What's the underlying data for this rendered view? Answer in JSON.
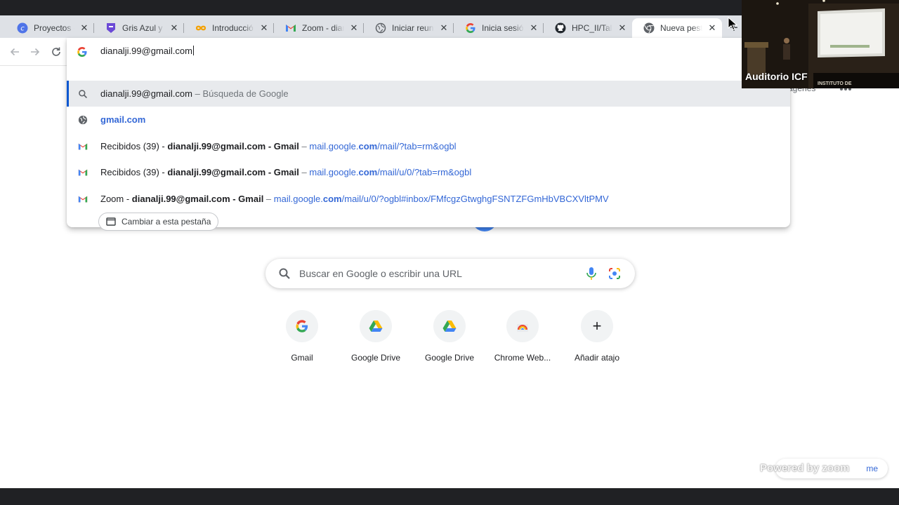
{
  "tabs": [
    {
      "label": "Proyectos - G",
      "icon": "canva-icon",
      "close": "✕"
    },
    {
      "label": "Gris Azul y N",
      "icon": "shield-icon",
      "close": "✕"
    },
    {
      "label": "Introducción",
      "icon": "infinity-icon",
      "close": "✕"
    },
    {
      "label": "Zoom - diana",
      "icon": "gmail-icon",
      "close": "✕"
    },
    {
      "label": "Iniciar reunió",
      "icon": "globe-icon",
      "close": "✕"
    },
    {
      "label": "Inicia sesión",
      "icon": "google-icon",
      "close": "✕"
    },
    {
      "label": "HPC_II/Taller",
      "icon": "github-icon",
      "close": "✕"
    },
    {
      "label": "Nueva pestañ",
      "icon": "chrome-icon",
      "close": "✕",
      "active": true
    }
  ],
  "new_tab_glyph": "+",
  "omnibox": {
    "value": "dianalji.99@gmail.com"
  },
  "suggestions": {
    "search": {
      "query": "dianalji.99@gmail.com",
      "sep": " – ",
      "hint": "Búsqueda de Google"
    },
    "site": {
      "label": "gmail.com"
    },
    "gmail1": {
      "pre": "Recibidos (39) - ",
      "bold": "dianalji.99@gmail.com - Gmail",
      "sep": " – ",
      "url_a": "mail.google.",
      "url_b": "com",
      "url_c": "/mail/?tab=rm&ogbl"
    },
    "gmail2": {
      "pre": "Recibidos (39) - ",
      "bold": "dianalji.99@gmail.com - Gmail",
      "sep": " – ",
      "url_a": "mail.google.",
      "url_b": "com",
      "url_c": "/mail/u/0/?tab=rm&ogbl"
    },
    "gmail3": {
      "pre": "Zoom - ",
      "bold": "dianalji.99@gmail.com - Gmail",
      "sep": " – ",
      "url_a": "mail.google.",
      "url_b": "com",
      "url_c": "/mail/u/0/?ogbl#inbox/FMfcgzGtwghgFSNTZFGmHbVBCXVltPMV"
    }
  },
  "switch_tab_label": "Cambiar a esta pestaña",
  "top_right_text": "ágenes",
  "search": {
    "placeholder": "Buscar en Google o escribir una URL"
  },
  "shortcuts": [
    {
      "label": "Gmail",
      "icon": "google-g-icon"
    },
    {
      "label": "Google Drive",
      "icon": "google-drive-icon"
    },
    {
      "label": "Google Drive",
      "icon": "google-drive-icon"
    },
    {
      "label": "Chrome Web...",
      "icon": "chrome-web-store-icon"
    },
    {
      "label": "Añadir atajo",
      "icon": "plus-icon",
      "glyph": "+"
    }
  ],
  "customize_label": "me",
  "watermark": "Powered by zoom",
  "video": {
    "participant": "Auditorio ICF",
    "sign": "INSTITUTO DE"
  },
  "colors": {
    "accent": "#0b57d0",
    "link": "#3367d6",
    "google_blue": "#4285f4",
    "google_red": "#ea4335",
    "google_yellow": "#fbbc05",
    "google_green": "#34a853"
  }
}
